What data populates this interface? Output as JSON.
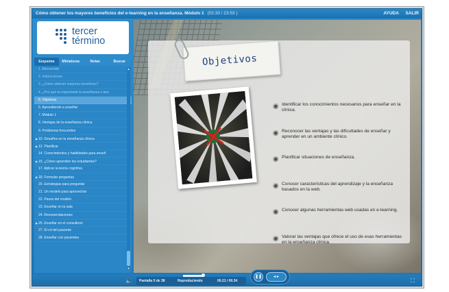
{
  "window": {
    "title": "Cómo obtener los mayores beneficios del e-learning en la enseñanza. Módulo 1",
    "time": "(02:33 / 23:53 )",
    "links": [
      "AYUDA",
      "SALIR"
    ]
  },
  "logo": {
    "line1": "tercer",
    "line2": "término"
  },
  "sidebar": {
    "tabs": [
      "Esquema",
      "Miniaturas",
      "Notas",
      "Buscar"
    ],
    "items": [
      {
        "label": "1. Bienvenido",
        "state": "visited"
      },
      {
        "label": "2. Instrucciones",
        "state": "visited"
      },
      {
        "label": "3. ¿Cómo obtener mayores beneficios?",
        "state": "visited"
      },
      {
        "label": "4. ¿Por qué es importante la enseñanza e-lear",
        "state": "visited"
      },
      {
        "label": "5. Objetivos",
        "state": "current"
      },
      {
        "label": "6. Aprendiendo a enseñar",
        "state": "normal"
      },
      {
        "label": "7. Módulo 1",
        "state": "normal"
      },
      {
        "label": "8. Ventajas de la enseñanza clínica",
        "state": "normal"
      },
      {
        "label": "9. Problemas frecuentes",
        "state": "normal"
      },
      {
        "label": "10. Desafíos en la enseñanza clínica",
        "state": "group"
      },
      {
        "label": "12. Planificar",
        "state": "group"
      },
      {
        "label": "14. Conocimientos y habilidades para enseñ",
        "state": "normal"
      },
      {
        "label": "15. ¿Cómo aprenden los estudiantes?",
        "state": "group"
      },
      {
        "label": "17. Aplicar la teoría cognitiva",
        "state": "normal"
      },
      {
        "label": "18. Formular preguntas",
        "state": "group"
      },
      {
        "label": "20. Estrategias para preguntar",
        "state": "normal"
      },
      {
        "label": "21. Un modelo para aprovechar",
        "state": "normal"
      },
      {
        "label": "22. Pasos del modelo",
        "state": "normal"
      },
      {
        "label": "23. Enseñar en la sala",
        "state": "normal"
      },
      {
        "label": "24. Recomendaciones",
        "state": "normal"
      },
      {
        "label": "25. Enseñar en el consultorio",
        "state": "group"
      },
      {
        "label": "27. El rol del paciente",
        "state": "normal"
      },
      {
        "label": "28. Enseñar con pacientes",
        "state": "normal"
      }
    ]
  },
  "slide": {
    "title": "Objetivos",
    "objectives": [
      "Identificar los conocimientos necesarios para enseñar en la clínica.",
      "Reconocer las ventajas y las dificultades de enseñar y aprender en un ambiente clínico.",
      "Planificar situaciones de enseñanza.",
      "Conocer características del aprendizaje y la enseñanza basados en la web.",
      "Conocer algunas herramientas web usadas en e-learning.",
      "Valorar las ventajas que ofrece el uso de esas herramientas en la enseñanza clínica."
    ]
  },
  "player": {
    "slide_counter": "Pantalla 5 de 38",
    "status": "Reproduciendo",
    "timer": "00.21 / 00.34",
    "progress": 0.62
  },
  "colors": {
    "player_blue": "#2d8fd0",
    "current_item": "#5aa7dd",
    "title_ink": "#1b3f7a"
  }
}
